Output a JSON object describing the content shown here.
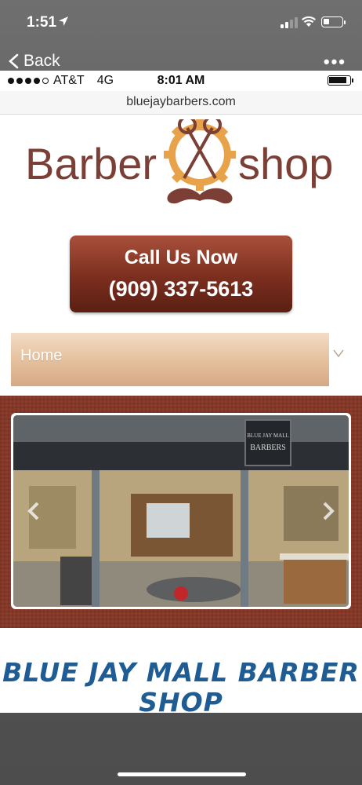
{
  "outer_status": {
    "time": "1:51"
  },
  "nav": {
    "back_label": "Back",
    "more_label": "•••"
  },
  "inner_status": {
    "carrier": "AT&T",
    "network": "4G",
    "time": "8:01 AM"
  },
  "url_bar": {
    "url": "bluejaybarbers.com"
  },
  "logo": {
    "word_left": "Barber",
    "word_right": "shop"
  },
  "call_button": {
    "title": "Call Us Now",
    "phone": "(909) 337-5613"
  },
  "menu": {
    "current": "Home"
  },
  "carousel": {
    "sign_top": "BLUE JAY MALL",
    "sign_bottom": "BARBERS"
  },
  "heading": {
    "line1": "BLUE JAY MALL BARBER",
    "line2": "SHOP"
  },
  "colors": {
    "brand_brown": "#7b2e1e",
    "heading_blue": "#1f5c94",
    "indicator_red": "#c0262a"
  }
}
